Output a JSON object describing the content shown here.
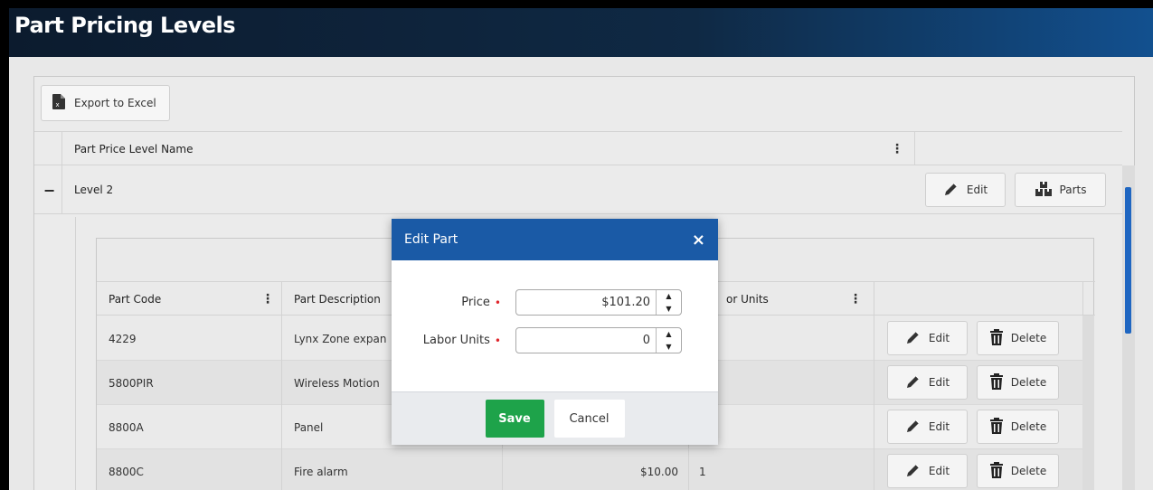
{
  "page": {
    "title": "Part Pricing Levels"
  },
  "toolbar": {
    "export_label": "Export to Excel"
  },
  "outer_grid": {
    "columns": [
      {
        "label": "Part Price Level Name"
      }
    ],
    "group_row": {
      "expand_symbol": "−",
      "name": "Level 2",
      "edit_label": "Edit",
      "parts_label": "Parts"
    }
  },
  "inner_grid": {
    "columns": [
      {
        "label": "Part Code"
      },
      {
        "label": "Part Description"
      },
      {
        "label": "or Units"
      }
    ],
    "rows": [
      {
        "code": "4229",
        "description": "Lynx Zone expan",
        "price": "",
        "units": ""
      },
      {
        "code": "5800PIR",
        "description": "Wireless Motion",
        "price": "",
        "units": ""
      },
      {
        "code": "8800A",
        "description": "Panel",
        "price": "",
        "units": ""
      },
      {
        "code": "8800C",
        "description": "Fire alarm",
        "price": "$10.00",
        "units": "1"
      }
    ],
    "edit_label": "Edit",
    "delete_label": "Delete"
  },
  "modal": {
    "title": "Edit Part",
    "close_symbol": "×",
    "fields": {
      "price": {
        "label": "Price",
        "value": "$101.20"
      },
      "labor_units": {
        "label": "Labor Units",
        "value": "0"
      }
    },
    "required_marker": "•",
    "save_label": "Save",
    "cancel_label": "Cancel"
  },
  "colors": {
    "header_bg": "#0f2944",
    "modal_header": "#1a5aa6",
    "save": "#1ea34a",
    "scroll_thumb": "#1f66c1"
  }
}
